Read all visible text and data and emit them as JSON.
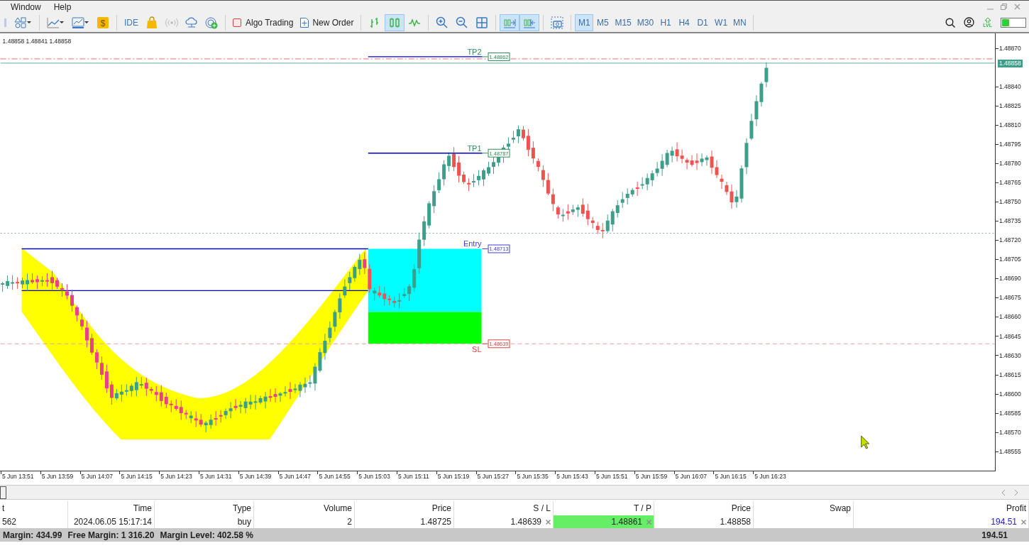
{
  "menu": [
    "Window",
    "Help"
  ],
  "toolbar": {
    "ide_label": "IDE",
    "algo_trading": {
      "label": "Algo Trading",
      "on": false
    },
    "new_order": "New Order",
    "chart_types": [
      {
        "selected": false
      },
      {
        "selected": true
      },
      {
        "selected": false
      }
    ],
    "autoscroll": {
      "on": true
    },
    "chart_shift": {
      "on": true
    },
    "timeframes": [
      {
        "label": "M1",
        "selected": true
      },
      {
        "label": "M5",
        "selected": false
      },
      {
        "label": "M15",
        "selected": false
      },
      {
        "label": "M30",
        "selected": false
      },
      {
        "label": "H1",
        "selected": false
      },
      {
        "label": "H4",
        "selected": false
      },
      {
        "label": "D1",
        "selected": false
      },
      {
        "label": "W1",
        "selected": false
      },
      {
        "label": "MN",
        "selected": false
      }
    ],
    "lvl_label": "LVL",
    "dollar_symbol": "$"
  },
  "chart": {
    "ohlc_text": "1.48858 1.48841 1.48858",
    "levels": [
      {
        "kind": "tp",
        "label": "TP2",
        "price": "1.48862"
      },
      {
        "kind": "tp",
        "label": "TP1",
        "price": "1.48787"
      },
      {
        "kind": "entry",
        "label": "Entry",
        "price": "1.48713"
      },
      {
        "kind": "sl",
        "label": "SL",
        "price": "1.48639"
      }
    ],
    "current_price": "1.48858",
    "price_ticks": [
      "1.48870",
      "1.48840",
      "1.48825",
      "1.48810",
      "1.48795",
      "1.48780",
      "1.48765",
      "1.48750",
      "1.48735",
      "1.48720",
      "1.48705",
      "1.48690",
      "1.48675",
      "1.48660",
      "1.48645",
      "1.48630",
      "1.48615",
      "1.48600",
      "1.48585",
      "1.48570",
      "1.48555"
    ],
    "time_ticks": [
      "5 Jun 13:51",
      "5 Jun 13:59",
      "5 Jun 14:07",
      "5 Jun 14:15",
      "5 Jun 14:23",
      "5 Jun 14:31",
      "5 Jun 14:39",
      "5 Jun 14:47",
      "5 Jun 14:55",
      "5 Jun 15:03",
      "5 Jun 15:11",
      "5 Jun 15:19",
      "5 Jun 15:27",
      "5 Jun 15:35",
      "5 Jun 15:43",
      "5 Jun 15:51",
      "5 Jun 15:59",
      "5 Jun 16:07",
      "5 Jun 16:15",
      "5 Jun 16:23"
    ]
  },
  "trades": {
    "columns": [
      "t",
      "Time",
      "Type",
      "Volume",
      "Price",
      "S / L",
      "T / P",
      "Price",
      "Swap",
      "Profit"
    ],
    "rows": [
      {
        "cells": [
          "562",
          "2024.06.05 15:17:14",
          "buy",
          "2",
          "1.48725",
          "1.48639",
          "1.48861",
          "1.48858",
          "",
          "194.51"
        ],
        "tp_hit": true
      }
    ],
    "summary": [
      "Margin: 434.99",
      "Free Margin: 1 316.20",
      "Margin Level: 402.58 %"
    ],
    "total": "194.51"
  }
}
